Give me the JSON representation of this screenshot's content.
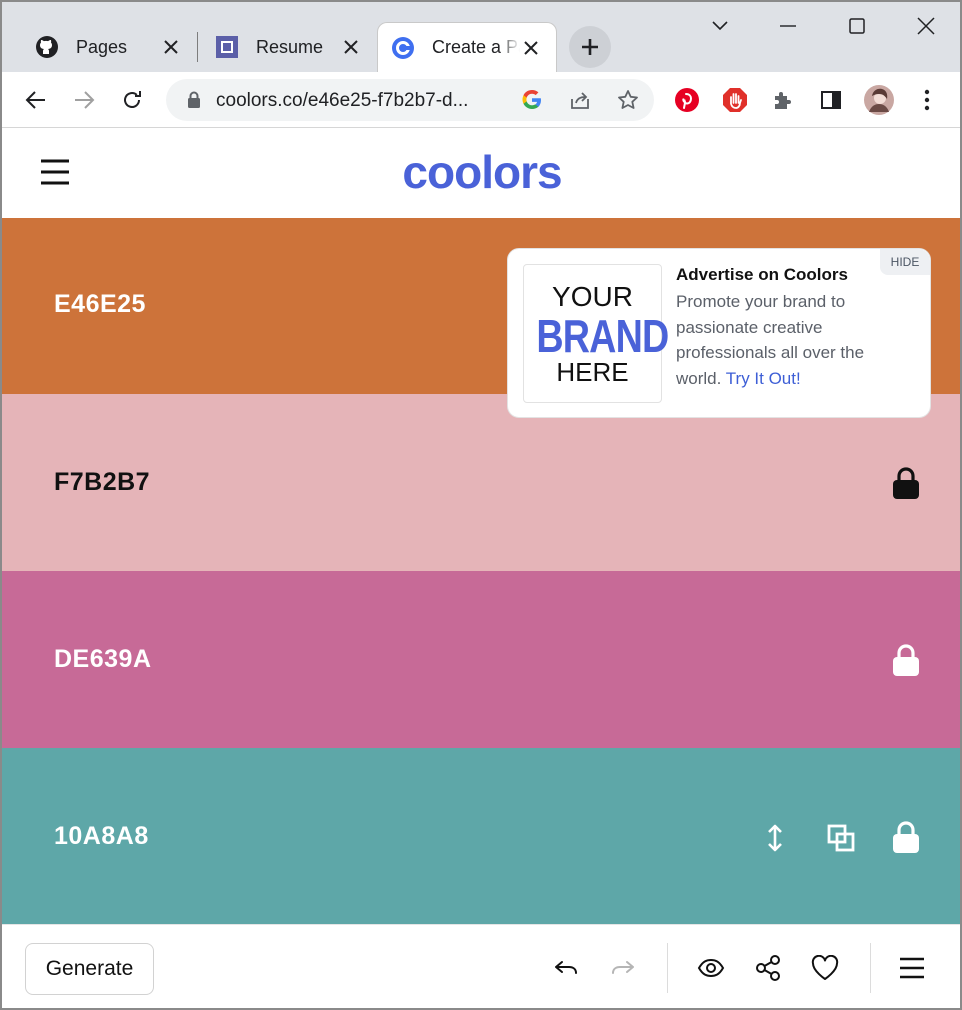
{
  "browser": {
    "tabs": [
      {
        "title": "Pages",
        "icon": "github-icon"
      },
      {
        "title": "Resume",
        "icon": "resume-icon"
      },
      {
        "title": "Create a Pa",
        "icon": "coolors-icon",
        "active": true
      }
    ],
    "url": "coolors.co/e46e25-f7b2b7-d..."
  },
  "app": {
    "logo_text": "coolors",
    "accent": "#4a62d8"
  },
  "palette": [
    {
      "hex": "E46E25",
      "display_color": "#cd733a",
      "text_color": "#ffffff"
    },
    {
      "hex": "F7B2B7",
      "display_color": "#e5b4b8",
      "text_color": "#111111"
    },
    {
      "hex": "DE639A",
      "display_color": "#c76a97",
      "text_color": "#ffffff"
    },
    {
      "hex": "10A8A8",
      "display_color": "#5ea7a8",
      "text_color": "#ffffff"
    }
  ],
  "ad": {
    "hide_label": "HIDE",
    "image_your": "YOUR",
    "image_brand": "BRAND",
    "image_here": "HERE",
    "title": "Advertise on Coolors",
    "body": "Promote your brand to passionate creative professionals all over the world.",
    "link": "Try It Out!"
  },
  "bottom": {
    "generate_label": "Generate"
  }
}
